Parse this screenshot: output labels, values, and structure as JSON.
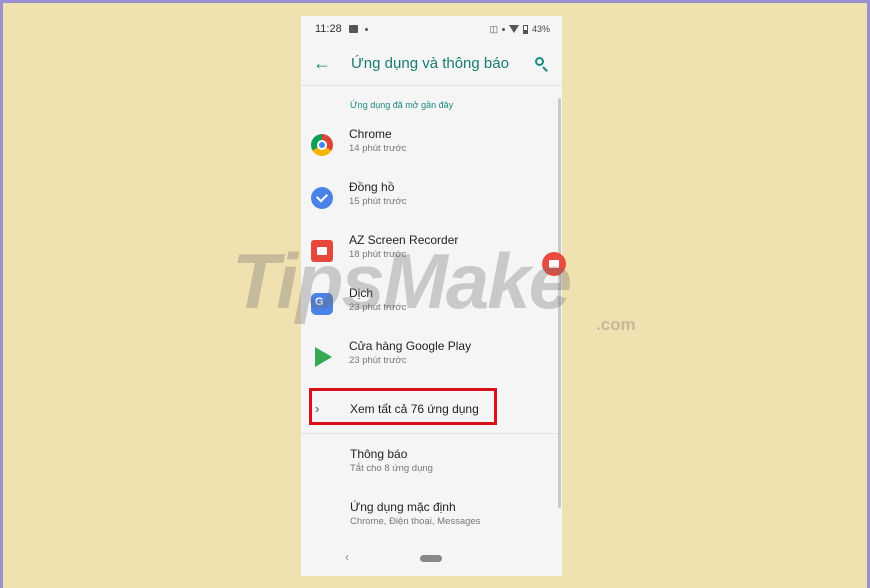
{
  "status_bar": {
    "time": "11:28",
    "battery": "43%"
  },
  "app_bar": {
    "title": "Ứng dụng và thông báo",
    "back_icon": "arrow-left-icon",
    "search_icon": "search-icon"
  },
  "recent_section": {
    "label": "Ứng dụng đã mở gần đây",
    "apps": [
      {
        "name": "Chrome",
        "time": "14 phút trước",
        "icon": "chrome-icon"
      },
      {
        "name": "Đồng hồ",
        "time": "15 phút trước",
        "icon": "clock-icon"
      },
      {
        "name": "AZ Screen Recorder",
        "time": "18 phút trước",
        "icon": "screen-recorder-icon"
      },
      {
        "name": "Dịch",
        "time": "23 phút trước",
        "icon": "translate-icon"
      },
      {
        "name": "Cửa hàng Google Play",
        "time": "23 phút trước",
        "icon": "play-store-icon"
      }
    ]
  },
  "see_all": {
    "label": "Xem tất cả 76 ứng dụng"
  },
  "settings": [
    {
      "title": "Thông báo",
      "subtitle": "Tắt cho 8 ứng dụng"
    },
    {
      "title": "Ứng dụng mặc định",
      "subtitle": "Chrome, Điện thoại, Messages"
    }
  ],
  "watermark": {
    "brand": "TipsMake",
    "suffix": ".com"
  },
  "colors": {
    "accent": "#1a8a7e",
    "highlight_border": "#d9101a",
    "background": "#efe1b0"
  }
}
